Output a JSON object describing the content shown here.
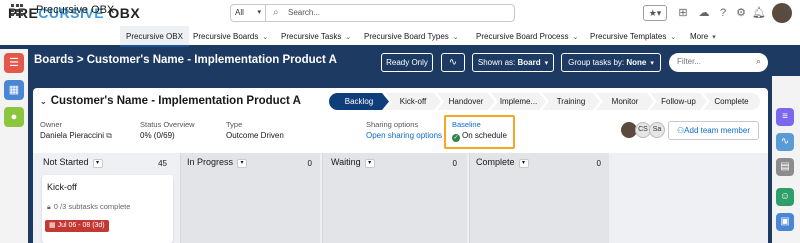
{
  "header": {
    "logo_left": "PRE",
    "logo_accent": "CURSIVE",
    "logo_right": " OBX",
    "search_scope": "All",
    "search_placeholder": "Search..."
  },
  "nav": {
    "app_name": "Precursive OBX",
    "tabs": [
      {
        "label": "Precursive OBX"
      },
      {
        "label": "Precursive Boards"
      },
      {
        "label": "Precursive Tasks"
      },
      {
        "label": "Precursive Board Types"
      },
      {
        "label": "Precursive Board Process"
      },
      {
        "label": "Precursive Templates"
      },
      {
        "label": "More"
      }
    ]
  },
  "toolbar": {
    "breadcrumb": "Boards > Customer's Name - Implementation Product A",
    "ready_only": "Ready Only",
    "shown_as_prefix": "Shown as: ",
    "shown_as_value": "Board",
    "group_by_prefix": "Group tasks by: ",
    "group_by_value": "None",
    "filter_placeholder": "Filter..."
  },
  "project": {
    "title": "Customer's Name - Implementation Product A",
    "stages": [
      "Backlog",
      "Kick-off",
      "Handover",
      "Impleme...",
      "Training",
      "Monitor",
      "Follow-up",
      "Complete"
    ],
    "current_stage": "Backlog",
    "owner_label": "Owner",
    "owner_value": "Daniela Pieraccini",
    "status_label": "Status Overview",
    "status_value": "0% (0/69)",
    "type_label": "Type",
    "type_value": "Outcome Driven",
    "sharing_label": "Sharing options",
    "sharing_value": "Open sharing options",
    "baseline_label": "Baseline",
    "baseline_value": "On schedule",
    "team_initials": [
      "CS",
      "Sa"
    ],
    "add_member": "Add team member"
  },
  "board": {
    "columns": [
      {
        "name": "Not Started",
        "count": "45"
      },
      {
        "name": "In Progress",
        "count": "0"
      },
      {
        "name": "Waiting",
        "count": "0"
      },
      {
        "name": "Complete",
        "count": "0"
      }
    ],
    "card": {
      "title": "Kick-off",
      "subtasks": "0 /3 subtasks complete",
      "date": "Jul 06 - 08 (3d)"
    }
  },
  "colors": {
    "brand_navy": "#1d3a63",
    "stage_current": "#0f3e7a",
    "baseline_highlight": "#f5a623",
    "late_red": "#c23934",
    "success_green": "#2e844a"
  }
}
